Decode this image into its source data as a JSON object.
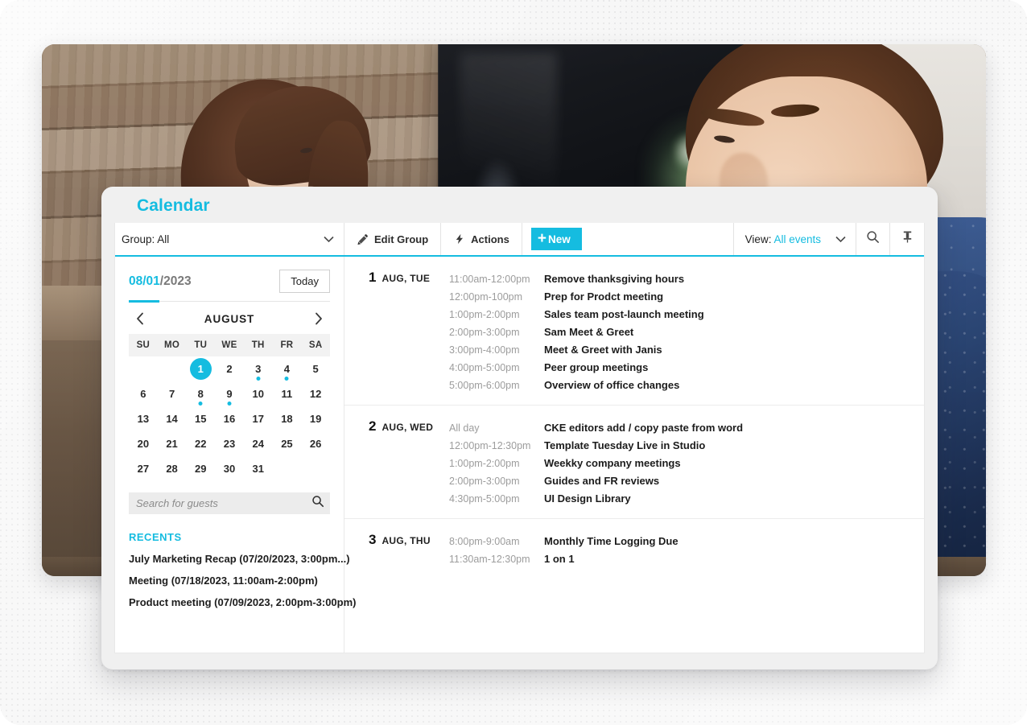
{
  "colors": {
    "accent": "#15bce0",
    "text": "#1c1c1c",
    "muted": "#9c9c9c",
    "card_bg": "#f0f0f0"
  },
  "card": {
    "title": "Calendar"
  },
  "toolbar": {
    "group_label": "Group: All",
    "edit_group_label": "Edit Group",
    "actions_label": "Actions",
    "new_label": "New",
    "new_plus": "+",
    "view_label": "View:",
    "view_value": "All events",
    "search_icon": "search-icon",
    "pin_icon": "pushpin-icon"
  },
  "sidebar": {
    "date_month_day": "08/01",
    "date_year": "/2023",
    "today_label": "Today",
    "mini_calendar": {
      "month": "AUGUST",
      "prev_icon": "chevron-left-icon",
      "next_icon": "chevron-right-icon",
      "dow": [
        "SU",
        "MO",
        "TU",
        "WE",
        "TH",
        "FR",
        "SA"
      ],
      "lead_blanks": 2,
      "days": [
        {
          "n": 1,
          "selected": true,
          "dot": false
        },
        {
          "n": 2,
          "selected": false,
          "dot": false
        },
        {
          "n": 3,
          "selected": false,
          "dot": true
        },
        {
          "n": 4,
          "selected": false,
          "dot": true
        },
        {
          "n": 5,
          "selected": false,
          "dot": false
        },
        {
          "n": 6,
          "selected": false,
          "dot": false
        },
        {
          "n": 7,
          "selected": false,
          "dot": false
        },
        {
          "n": 8,
          "selected": false,
          "dot": true
        },
        {
          "n": 9,
          "selected": false,
          "dot": true
        },
        {
          "n": 10,
          "selected": false,
          "dot": false
        },
        {
          "n": 11,
          "selected": false,
          "dot": false
        },
        {
          "n": 12,
          "selected": false,
          "dot": false
        },
        {
          "n": 13,
          "selected": false,
          "dot": false
        },
        {
          "n": 14,
          "selected": false,
          "dot": false
        },
        {
          "n": 15,
          "selected": false,
          "dot": false
        },
        {
          "n": 16,
          "selected": false,
          "dot": false
        },
        {
          "n": 17,
          "selected": false,
          "dot": false
        },
        {
          "n": 18,
          "selected": false,
          "dot": false
        },
        {
          "n": 19,
          "selected": false,
          "dot": false
        },
        {
          "n": 20,
          "selected": false,
          "dot": false
        },
        {
          "n": 21,
          "selected": false,
          "dot": false
        },
        {
          "n": 22,
          "selected": false,
          "dot": false
        },
        {
          "n": 23,
          "selected": false,
          "dot": false
        },
        {
          "n": 24,
          "selected": false,
          "dot": false
        },
        {
          "n": 25,
          "selected": false,
          "dot": false
        },
        {
          "n": 26,
          "selected": false,
          "dot": false
        },
        {
          "n": 27,
          "selected": false,
          "dot": false
        },
        {
          "n": 28,
          "selected": false,
          "dot": false
        },
        {
          "n": 29,
          "selected": false,
          "dot": false
        },
        {
          "n": 30,
          "selected": false,
          "dot": false
        },
        {
          "n": 31,
          "selected": false,
          "dot": false
        }
      ]
    },
    "guest_search": {
      "value": "",
      "placeholder": "Search for guests",
      "icon": "search-icon"
    },
    "recents_heading": "RECENTS",
    "recents": [
      "July Marketing Recap (07/20/2023, 3:00pm...)",
      "Meeting (07/18/2023, 11:00am-2:00pm)",
      "Product meeting (07/09/2023, 2:00pm-3:00pm)"
    ]
  },
  "events": {
    "days": [
      {
        "num": "1",
        "dow": "AUG, TUE",
        "items": [
          {
            "time": "11:00am-12:00pm",
            "title": "Remove thanksgiving hours"
          },
          {
            "time": "12:00pm-100pm",
            "title": "Prep for Prodct meeting"
          },
          {
            "time": "1:00pm-2:00pm",
            "title": "Sales team post-launch meeting"
          },
          {
            "time": "2:00pm-3:00pm",
            "title": "Sam Meet & Greet"
          },
          {
            "time": "3:00pm-4:00pm",
            "title": "Meet & Greet with Janis"
          },
          {
            "time": "4:00pm-5:00pm",
            "title": "Peer group meetings"
          },
          {
            "time": "5:00pm-6:00pm",
            "title": "Overview of office changes"
          }
        ]
      },
      {
        "num": "2",
        "dow": "AUG, WED",
        "items": [
          {
            "time": "All day",
            "title": "CKE editors add / copy paste from word"
          },
          {
            "time": "12:00pm-12:30pm",
            "title": "Template Tuesday Live in Studio"
          },
          {
            "time": "1:00pm-2:00pm",
            "title": "Weekky company meetings"
          },
          {
            "time": "2:00pm-3:00pm",
            "title": "Guides and FR reviews"
          },
          {
            "time": "4:30pm-5:00pm",
            "title": "UI Design Library"
          }
        ]
      },
      {
        "num": "3",
        "dow": "AUG, THU",
        "items": [
          {
            "time": "8:00pm-9:00am",
            "title": "Monthly Time Logging Due"
          },
          {
            "time": "11:30am-12:30pm",
            "title": "1 on 1"
          }
        ]
      }
    ]
  }
}
